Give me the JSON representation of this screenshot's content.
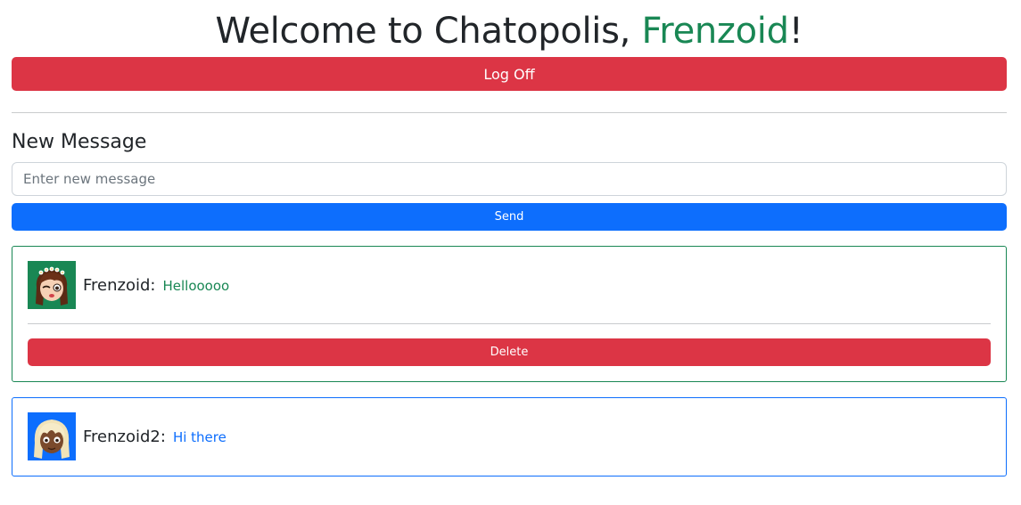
{
  "header": {
    "title_prefix": "Welcome to Chatopolis, ",
    "username": "Frenzoid",
    "title_suffix": "!",
    "logoff_label": "Log Off"
  },
  "composer": {
    "heading": "New Message",
    "input_value": "",
    "input_placeholder": "Enter new message",
    "send_label": "Send"
  },
  "messages": [
    {
      "author": "Frenzoid:",
      "text": "Hellooooo",
      "delete_label": "Delete",
      "avatar_icon": "girl-avatar-icon",
      "accent": "#198754"
    },
    {
      "author": "Frenzoid2:",
      "text": "Hi there",
      "avatar_icon": "blonde-avatar-icon",
      "accent": "#0d6efd"
    }
  ],
  "colors": {
    "danger": "#dc3545",
    "primary": "#0d6efd",
    "success": "#198754"
  }
}
